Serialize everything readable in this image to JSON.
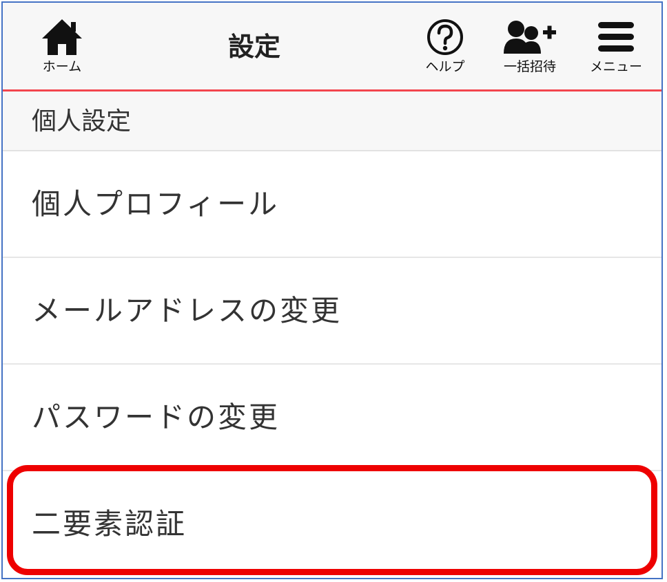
{
  "header": {
    "title": "設定",
    "home_label": "ホーム",
    "help_label": "ヘルプ",
    "invite_label": "一括招待",
    "menu_label": "メニュー",
    "accent_color": "#f2464e"
  },
  "icons": {
    "home": "home-icon",
    "help": "help-circle-icon",
    "invite": "add-users-icon",
    "menu": "hamburger-menu-icon"
  },
  "section": {
    "title": "個人設定"
  },
  "items": [
    {
      "label": "個人プロフィール"
    },
    {
      "label": "メールアドレスの変更"
    },
    {
      "label": "パスワードの変更"
    },
    {
      "label": "二要素認証"
    }
  ],
  "highlight_color": "#ee0000"
}
